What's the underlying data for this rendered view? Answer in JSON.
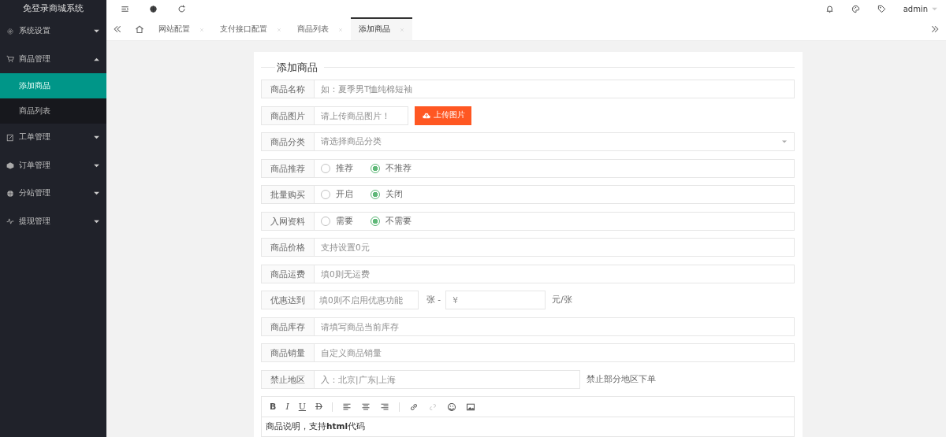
{
  "sidebar": {
    "title": "免登录商城系统",
    "items": [
      {
        "label": "系统设置",
        "expanded": false
      },
      {
        "label": "商品管理",
        "expanded": true,
        "children": [
          {
            "label": "添加商品",
            "selected": true
          },
          {
            "label": "商品列表",
            "selected": false
          }
        ]
      },
      {
        "label": "工单管理",
        "expanded": false
      },
      {
        "label": "订单管理",
        "expanded": false
      },
      {
        "label": "分站管理",
        "expanded": false
      },
      {
        "label": "提现管理",
        "expanded": false
      }
    ]
  },
  "header": {
    "user": "admin"
  },
  "tabs": [
    {
      "label": "网站配置",
      "selected": false
    },
    {
      "label": "支付接口配置",
      "selected": false
    },
    {
      "label": "商品列表",
      "selected": false
    },
    {
      "label": "添加商品",
      "selected": true
    }
  ],
  "form": {
    "title": "添加商品",
    "rows": [
      {
        "kind": "text",
        "label": "商品名称",
        "placeholder": "如：夏季男T恤纯棉短袖"
      },
      {
        "kind": "upload",
        "label": "商品图片",
        "placeholder": "请上传商品图片！",
        "button": "上传图片"
      },
      {
        "kind": "select",
        "label": "商品分类",
        "placeholder": "请选择商品分类"
      },
      {
        "kind": "radio",
        "label": "商品推荐",
        "options": [
          {
            "label": "推荐",
            "selected": false
          },
          {
            "label": "不推荐",
            "selected": true
          }
        ]
      },
      {
        "kind": "radio",
        "label": "批量购买",
        "options": [
          {
            "label": "开启",
            "selected": false
          },
          {
            "label": "关闭",
            "selected": true
          }
        ]
      },
      {
        "kind": "radio",
        "label": "入网资料",
        "options": [
          {
            "label": "需要",
            "selected": false
          },
          {
            "label": "不需要",
            "selected": true
          }
        ]
      },
      {
        "kind": "text",
        "label": "商品价格",
        "placeholder": "支持设置0元"
      },
      {
        "kind": "text",
        "label": "商品运费",
        "placeholder": "填0则无运费"
      },
      {
        "kind": "pair",
        "label": "优惠达到",
        "placeholder": "填0则不启用优惠功能",
        "middle": "张 -",
        "placeholder_2": "¥",
        "suffix": "元/张"
      },
      {
        "kind": "text",
        "label": "商品库存",
        "placeholder": "请填写商品当前库存"
      },
      {
        "kind": "text",
        "label": "商品销量",
        "placeholder": "自定义商品销量"
      },
      {
        "kind": "note",
        "label": "禁止地区",
        "placeholder": "入：北京|广东|上海",
        "note": "禁止部分地区下单"
      }
    ],
    "editor": {
      "tools": [
        "B",
        "I",
        "U",
        "D"
      ],
      "text": "商品说明，支持**html**代码"
    }
  }
}
